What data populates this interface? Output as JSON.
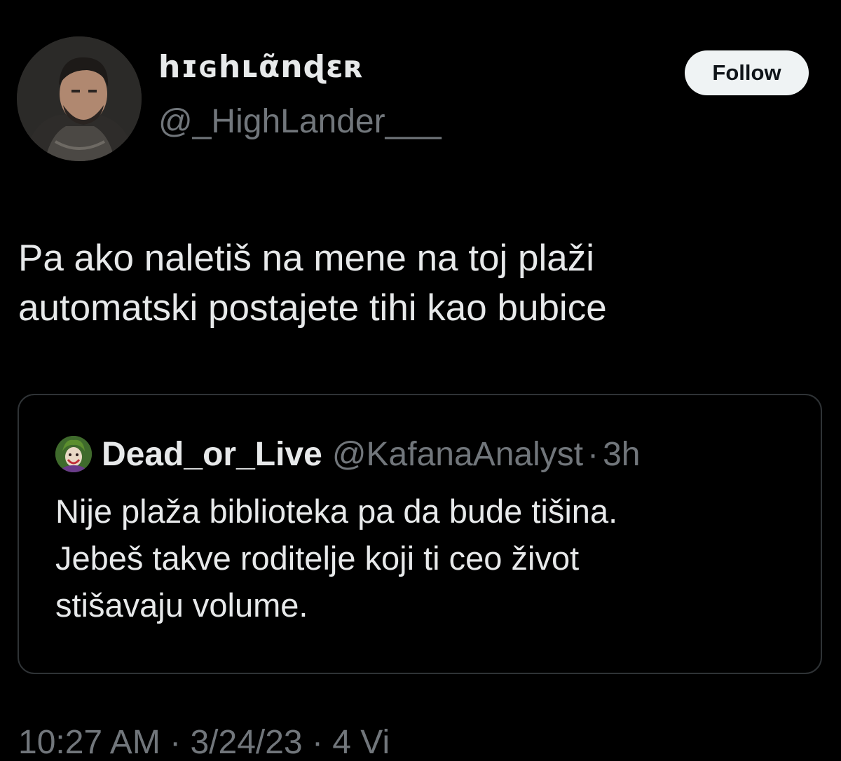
{
  "author": {
    "display_name": "hɪɢhʟᾶnɖɛʀ",
    "handle": "@_HighLander___",
    "avatar_icon": "profile-photo-warrior"
  },
  "follow_button": {
    "label": "Follow"
  },
  "tweet": {
    "lines": [
      "Pa ako naletiš na mene na toj plaži",
      "automatski postajete tihi kao bubice"
    ]
  },
  "quoted_tweet": {
    "display_name": "Dead_or_Live",
    "handle": "@KafanaAnalyst",
    "separator": "·",
    "time": "3h",
    "avatar_icon": "joker-avatar",
    "lines": [
      "Nije plaža biblioteka pa da bude tišina.",
      "Jebeš takve roditelje koji ti ceo život",
      "stišavaju volume."
    ]
  },
  "footer": {
    "partial_meta": "10:27 AM · 3/24/23 · 4 Vi"
  },
  "colors": {
    "background": "#000000",
    "text_primary": "#e7e9ea",
    "text_secondary": "#71767b",
    "border": "#2f3336",
    "button_bg": "#eff3f4"
  }
}
